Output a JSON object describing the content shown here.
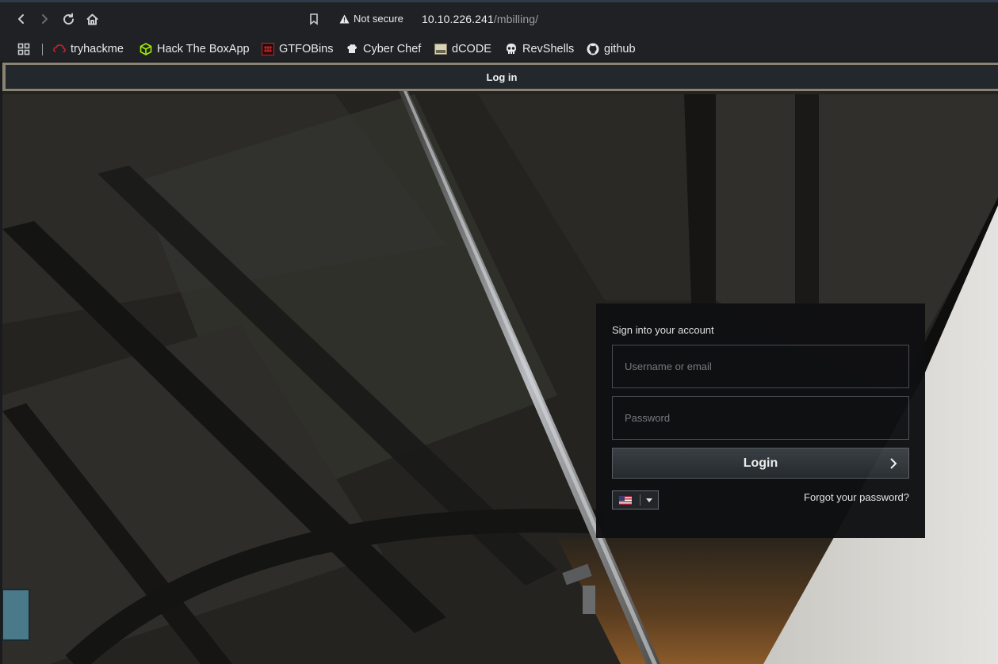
{
  "browser": {
    "security_label": "Not secure",
    "url_host": "10.10.226.241",
    "url_path": "/mbilling/"
  },
  "bookmarks": [
    {
      "label": "tryhackme",
      "icon": "tryhackme-icon"
    },
    {
      "label": "Hack The BoxApp",
      "icon": "hackthebox-icon"
    },
    {
      "label": "GTFOBins",
      "icon": "gtfobins-icon"
    },
    {
      "label": "Cyber Chef",
      "icon": "cyberchef-icon"
    },
    {
      "label": "dCODE",
      "icon": "dcode-icon"
    },
    {
      "label": "RevShells",
      "icon": "skull-icon"
    },
    {
      "label": "github",
      "icon": "github-icon"
    }
  ],
  "page": {
    "header_title": "Log in"
  },
  "login": {
    "title": "Sign into your account",
    "username_placeholder": "Username or email",
    "password_placeholder": "Password",
    "button_label": "Login",
    "forgot_label": "Forgot your password?",
    "language": "en-US"
  }
}
